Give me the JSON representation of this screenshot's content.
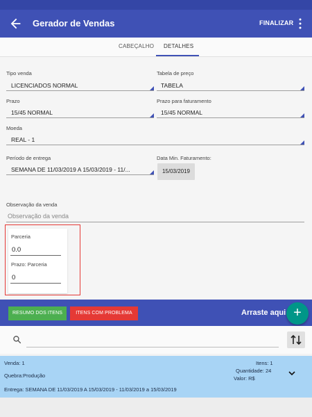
{
  "app": {
    "title": "Gerador de Vendas",
    "finalize_label": "FINALIZAR",
    "back_icon": "arrow-left-icon",
    "more_icon": "more-vert-icon"
  },
  "tabs": [
    {
      "label": "CABEÇALHO",
      "selected": false
    },
    {
      "label": "DETALHES",
      "selected": true
    }
  ],
  "form": {
    "tipo_venda": {
      "label": "Tipo venda",
      "value": "LICENCIADOS NORMAL"
    },
    "tabela_preco": {
      "label": "Tabela de preço",
      "value": "TABELA"
    },
    "prazo": {
      "label": "Prazo",
      "value": "15/45 NORMAL"
    },
    "prazo_faturamento": {
      "label": "Prazo para faturamento",
      "value": "15/45 NORMAL"
    },
    "moeda": {
      "label": "Moeda",
      "value": "REAL - 1"
    },
    "periodo_entrega": {
      "label": "Período de entrega",
      "value": "SEMANA DE 11/03/2019 A 15/03/2019 - 11/..."
    },
    "data_min_faturamento": {
      "label": "Data Min. Faturamento:",
      "value": "15/03/2019"
    },
    "observacao": {
      "label": "Observação da venda",
      "placeholder": "Observação da venda"
    }
  },
  "parceria": {
    "label": "Parceria",
    "value": "0.0",
    "prazo_label": "Prazo:  Parceria",
    "prazo_value": "0"
  },
  "bottom_bar": {
    "resumo_label": "RESUMO DOS ITENS",
    "problema_label": "ITENS COM PROBLEMA",
    "drag_label": "Arraste aqui",
    "fab_icon": "plus-icon"
  },
  "search": {
    "icon": "search-icon",
    "placeholder": "",
    "sort_icon": "swap-vertical-icon"
  },
  "order_card": {
    "venda": "Venda: 1",
    "quebra": "Quebra:Produção",
    "entrega": "Entrega: SEMANA DE 11/03/2019 A 15/03/2019 - 11/03/2019 a 15/03/2019",
    "itens": "Itens: 1",
    "quantidade": "Quantidade: 24",
    "valor": "Valor: R$",
    "expand_icon": "chevron-down-icon"
  },
  "colors": {
    "primary": "#3f51b5",
    "green": "#4caf50",
    "red": "#e53935",
    "fab": "#009688",
    "card": "#a8d4f5"
  }
}
